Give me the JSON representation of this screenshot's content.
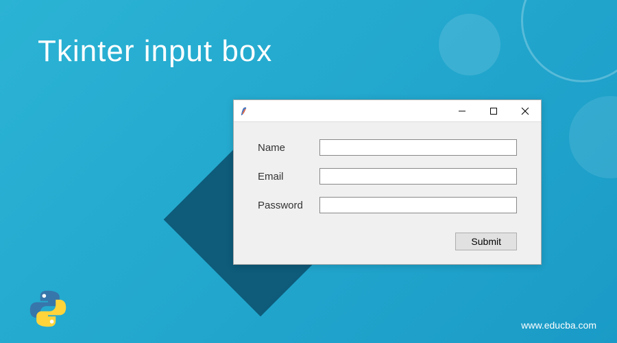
{
  "page": {
    "title": "Tkinter input box",
    "footer_url": "www.educba.com"
  },
  "window": {
    "title": ""
  },
  "form": {
    "name_label": "Name",
    "name_value": "",
    "email_label": "Email",
    "email_value": "",
    "password_label": "Password",
    "password_value": "",
    "submit_label": "Submit"
  }
}
